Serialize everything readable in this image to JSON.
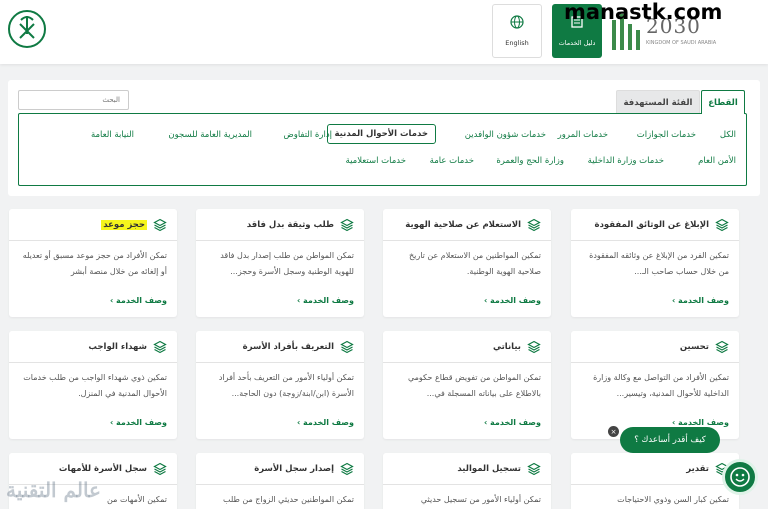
{
  "header": {
    "lang_label": "English",
    "guide_label": "دليل الخدمات",
    "vision_year": "2030",
    "vision_sub": "KINGDOM OF SAUDI ARABIA",
    "watermark": "manastk.com"
  },
  "filter": {
    "search_placeholder": "البحث",
    "tabs": {
      "sector": "القطاع",
      "target": "الفئة المستهدفة"
    },
    "sectors_row1": [
      "الكل",
      "خدمات الجوازات",
      "خدمات المرور",
      "خدمات شؤون الوافدين",
      "خدمات الأحوال المدنية",
      "إدارة التفاوض",
      "المديرية العامة للسجون",
      "النيابة العامة"
    ],
    "sectors_row2": [
      "الأمن العام",
      "خدمات وزارة الداخلية",
      "وزارة الحج والعمرة",
      "خدمات عامة",
      "خدمات استعلامية"
    ],
    "active_sector": "خدمات الأحوال المدنية"
  },
  "cards": [
    {
      "title": "الإبلاغ عن الوثائق المفقودة",
      "desc": "تمكين الفرد من الإبلاغ عن وثائقه المفقودة من خلال حساب صاحب الـ...",
      "more": "وصف الخدمة ›"
    },
    {
      "title": "الاستعلام عن صلاحية الهوية",
      "desc": "تمكين المواطنين من الاستعلام عن تاريخ صلاحية الهوية الوطنية.",
      "more": "وصف الخدمة ›"
    },
    {
      "title": "طلب وثيقة بدل فاقد",
      "desc": "تمكن المواطن من طلب إصدار بدل فاقد للهوية الوطنية وسجل الأسرة وحجز...",
      "more": "وصف الخدمة ›"
    },
    {
      "title": "حجز موعد",
      "desc": "تمكن الأفراد من حجز موعد مسبق أو تعديله أو إلغائه من خلال منصة أبشر",
      "more": "وصف الخدمة ›"
    },
    {
      "title": "تحسين",
      "desc": "تمكين الأفراد من التواصل مع وكالة وزارة الداخلية للأحوال المدنية، وتيسير...",
      "more": "وصف الخدمة ›"
    },
    {
      "title": "بياناتي",
      "desc": "تمكن المواطن من تفويض قطاع حكومي بالاطلاع على بياناته المسجلة في...",
      "more": "وصف الخدمة ›"
    },
    {
      "title": "التعريف بأفراد الأسرة",
      "desc": "تمكن أولياء الأمور من التعريف بأحد أفراد الأسرة (ابن/ابنة/زوجة) دون الحاجة...",
      "more": "وصف الخدمة ›"
    },
    {
      "title": "شهداء الواجب",
      "desc": "تمكين ذوي شهداء الواجب من طلب خدمات الأحوال المدنية في المنزل.",
      "more": "وصف الخدمة ›"
    },
    {
      "title": "تقدير",
      "desc": "تمكين كبار السن وذوي الاحتياجات",
      "more": ""
    },
    {
      "title": "تسجيل المواليد",
      "desc": "تمكن أولياء الأمور من تسجيل حديثي",
      "more": ""
    },
    {
      "title": "إصدار سجل الأسرة",
      "desc": "تمكن المواطنين حديثي الزواج من طلب",
      "more": ""
    },
    {
      "title": "سجل الأسرة للأمهات",
      "desc": "تمكين الأمهات من",
      "more": ""
    }
  ],
  "chat": {
    "bubble": "كيف أقدر أساعدك ؟",
    "close": "×"
  },
  "overlay_text": "عالم التقنية"
}
